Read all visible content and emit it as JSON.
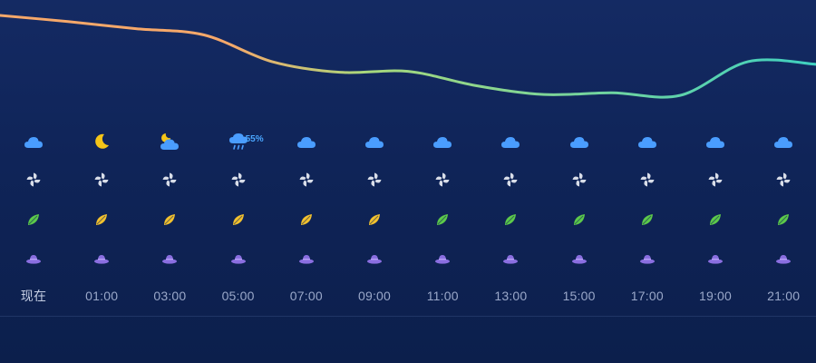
{
  "colors": {
    "bg_top": "#142a63",
    "bg_bottom": "#0c1f4c",
    "curve_warm": "#f6a86a",
    "curve_mid": "#a8d87c",
    "curve_cool": "#3fd0c0",
    "cloud": "#4a9dff",
    "moon": "#f5c518",
    "wind_icon": "#d8dde8",
    "leaf_green": "#5cc94a",
    "leaf_yellow": "#f2c12e",
    "hat": "#8a6ee0",
    "precip_text": "#4aa6ff",
    "time_text": "#9aa8c9"
  },
  "temperature_curve": {
    "relative_levels": [
      0.97,
      0.9,
      0.82,
      0.75,
      0.45,
      0.33,
      0.34,
      0.18,
      0.08,
      0.1,
      0.07,
      0.45,
      0.42
    ]
  },
  "hours": [
    {
      "time": "现在",
      "weather_icon": "cloud-icon",
      "precip": "",
      "wind_icon": "pinwheel-icon",
      "leaf_color": "green",
      "leaf_icon": "leaf-icon",
      "hat_icon": "hat-icon"
    },
    {
      "time": "01:00",
      "weather_icon": "moon-icon",
      "precip": "",
      "wind_icon": "pinwheel-icon",
      "leaf_color": "yellow",
      "leaf_icon": "leaf-icon",
      "hat_icon": "hat-icon"
    },
    {
      "time": "03:00",
      "weather_icon": "moon-cloud-icon",
      "precip": "",
      "wind_icon": "pinwheel-icon",
      "leaf_color": "yellow",
      "leaf_icon": "leaf-icon",
      "hat_icon": "hat-icon"
    },
    {
      "time": "05:00",
      "weather_icon": "rain-cloud-icon",
      "precip": "55%",
      "wind_icon": "pinwheel-icon",
      "leaf_color": "yellow",
      "leaf_icon": "leaf-icon",
      "hat_icon": "hat-icon"
    },
    {
      "time": "07:00",
      "weather_icon": "cloud-icon",
      "precip": "",
      "wind_icon": "pinwheel-icon",
      "leaf_color": "yellow",
      "leaf_icon": "leaf-icon",
      "hat_icon": "hat-icon"
    },
    {
      "time": "09:00",
      "weather_icon": "cloud-icon",
      "precip": "",
      "wind_icon": "pinwheel-icon",
      "leaf_color": "yellow",
      "leaf_icon": "leaf-icon",
      "hat_icon": "hat-icon"
    },
    {
      "time": "11:00",
      "weather_icon": "cloud-icon",
      "precip": "",
      "wind_icon": "pinwheel-icon",
      "leaf_color": "green",
      "leaf_icon": "leaf-icon",
      "hat_icon": "hat-icon"
    },
    {
      "time": "13:00",
      "weather_icon": "cloud-icon",
      "precip": "",
      "wind_icon": "pinwheel-icon",
      "leaf_color": "green",
      "leaf_icon": "leaf-icon",
      "hat_icon": "hat-icon"
    },
    {
      "time": "15:00",
      "weather_icon": "cloud-icon",
      "precip": "",
      "wind_icon": "pinwheel-icon",
      "leaf_color": "green",
      "leaf_icon": "leaf-icon",
      "hat_icon": "hat-icon"
    },
    {
      "time": "17:00",
      "weather_icon": "cloud-icon",
      "precip": "",
      "wind_icon": "pinwheel-icon",
      "leaf_color": "green",
      "leaf_icon": "leaf-icon",
      "hat_icon": "hat-icon"
    },
    {
      "time": "19:00",
      "weather_icon": "cloud-icon",
      "precip": "",
      "wind_icon": "pinwheel-icon",
      "leaf_color": "green",
      "leaf_icon": "leaf-icon",
      "hat_icon": "hat-icon"
    },
    {
      "time": "21:00",
      "weather_icon": "cloud-icon",
      "precip": "",
      "wind_icon": "pinwheel-icon",
      "leaf_color": "green",
      "leaf_icon": "leaf-icon",
      "hat_icon": "hat-icon"
    }
  ]
}
